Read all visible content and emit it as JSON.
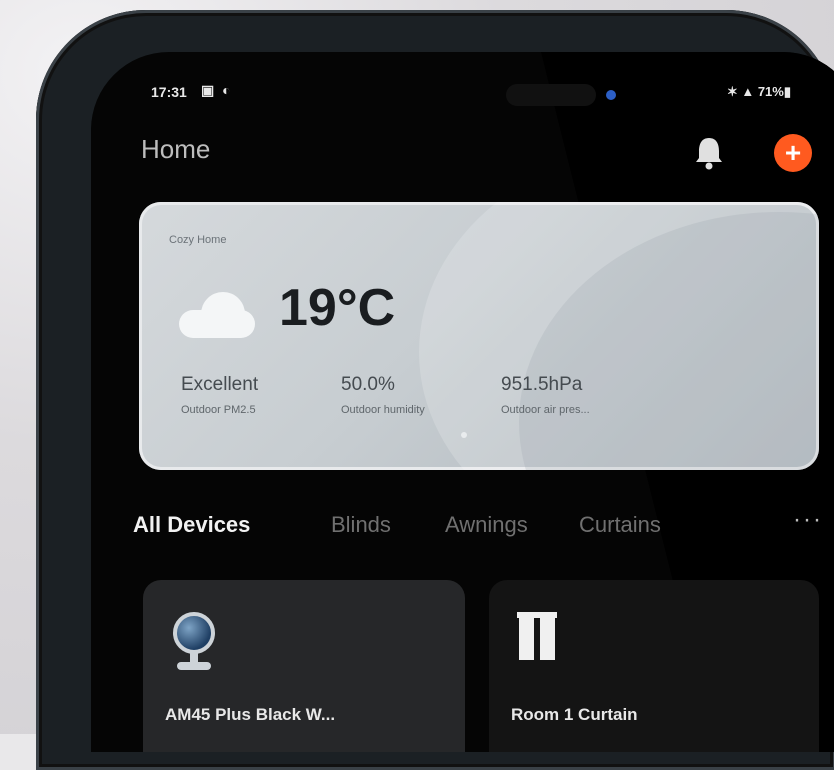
{
  "status_bar": {
    "time": "17:31",
    "left_icons": "▣ ◐",
    "right": "✶ ▲ 71%▮"
  },
  "header": {
    "title": "Home",
    "icons": {
      "notifications": "bell-icon",
      "add": "plus-icon"
    },
    "add_symbol": "+",
    "colors": {
      "add_button": "#ff5a1f"
    }
  },
  "weather": {
    "location": "Cozy Home",
    "temperature": "19°C",
    "icon": "cloud-icon",
    "metrics": [
      {
        "value": "Excellent",
        "label": "Outdoor PM2.5"
      },
      {
        "value": "50.0%",
        "label": "Outdoor humidity"
      },
      {
        "value": "951.5hPa",
        "label": "Outdoor air pres..."
      }
    ]
  },
  "tabs": {
    "items": [
      "All Devices",
      "Blinds",
      "Awnings",
      "Curtains"
    ],
    "active": "All Devices",
    "more": "···"
  },
  "devices": [
    {
      "name": "AM45 Plus Black W...",
      "icon": "webcam-icon"
    },
    {
      "name": "Room 1 Curtain",
      "icon": "curtain-icon"
    }
  ]
}
